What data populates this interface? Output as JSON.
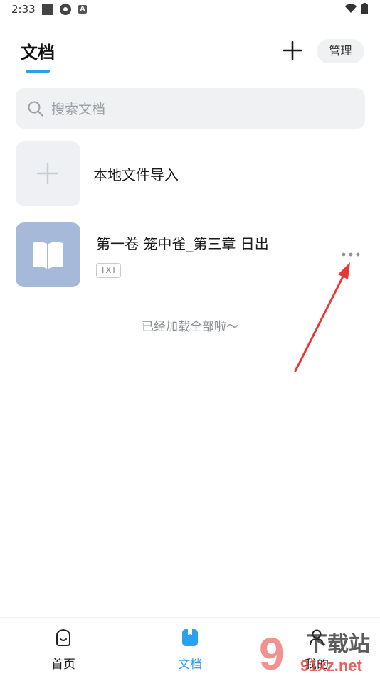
{
  "status_bar": {
    "time": "2:33",
    "a_badge": "A"
  },
  "header": {
    "title": "文档",
    "manage_label": "管理"
  },
  "search": {
    "placeholder": "搜索文档",
    "value": ""
  },
  "import": {
    "label": "本地文件导入"
  },
  "documents": [
    {
      "title": "第一卷 笼中雀_第三章 日出",
      "type": "TXT"
    }
  ],
  "list_end_text": "已经加载全部啦～",
  "bottom_nav": {
    "items": [
      {
        "label": "首页",
        "active": false
      },
      {
        "label": "文档",
        "active": true
      },
      {
        "label": "我的",
        "active": false
      }
    ]
  },
  "watermark": {
    "text_top": "下载站",
    "text_bottom": "91xz.net"
  },
  "colors": {
    "accent": "#2aa0ef",
    "annotation_arrow": "#e53935",
    "cover": "#a6b9d9"
  }
}
